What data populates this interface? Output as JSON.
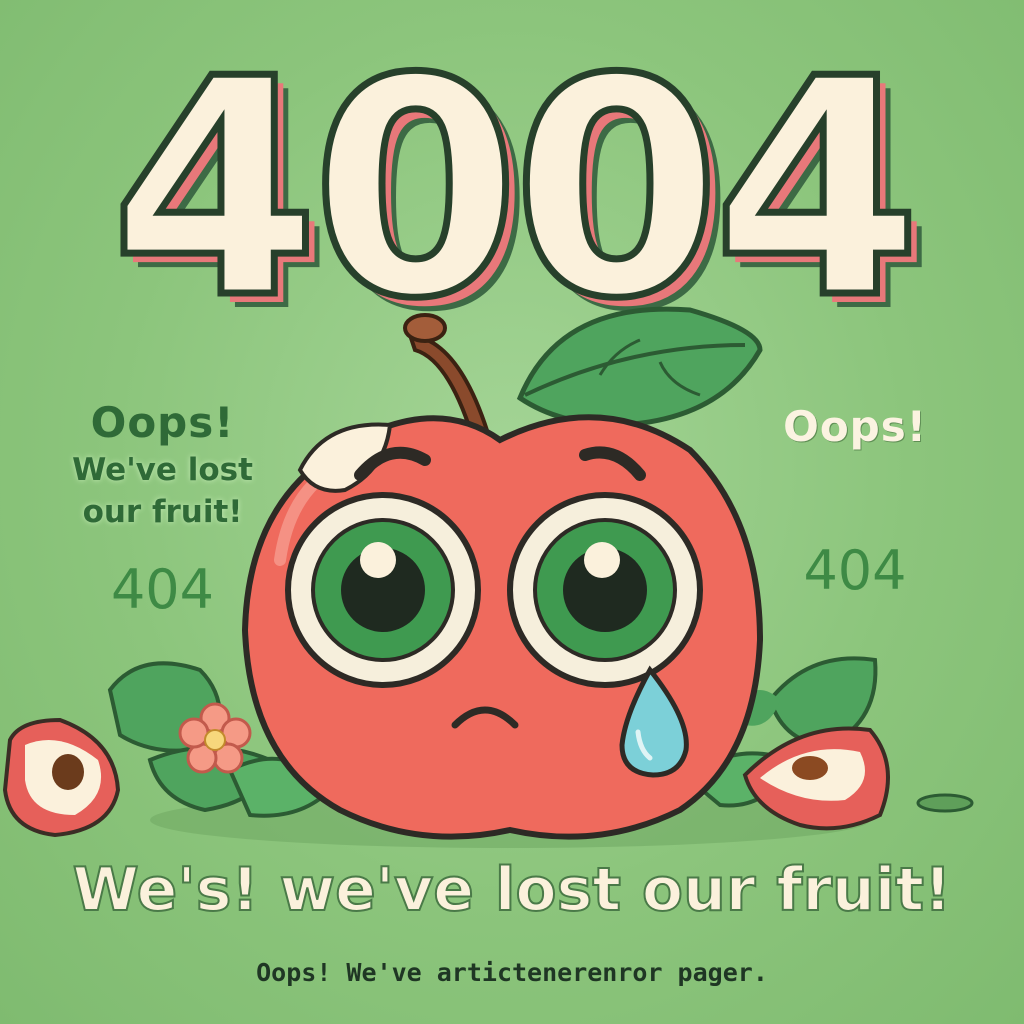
{
  "hero": {
    "code": "4004",
    "headline": "We's! we've lost our fruit!",
    "footer": "Oops! We've artictenerenror pager."
  },
  "left_panel": {
    "oops": "Oops!",
    "line1": "We've lost",
    "line2": "our fruit!",
    "code": "404"
  },
  "right_panel": {
    "oops": "Oops!",
    "code": "404"
  },
  "colors": {
    "background": "#8ec77e",
    "apple": "#ef6a5d",
    "leaf": "#3f9a50",
    "text_cream": "#fbf1dc",
    "text_dark_green": "#2f6a37"
  },
  "icons": [
    "sad-apple-illustration",
    "leaf-icon",
    "flower-icon",
    "tear-drop-icon",
    "apple-half-icon"
  ]
}
